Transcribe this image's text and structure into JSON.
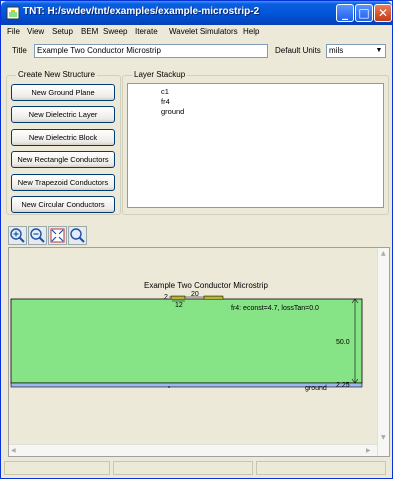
{
  "window": {
    "title": "TNT:  H:/swdev/tnt/examples/example-microstrip-2",
    "minimize_glyph": "_",
    "maximize_glyph": "□",
    "close_glyph": "✕"
  },
  "menu": [
    "File",
    "View",
    "Setup",
    "BEM",
    "Sweep",
    "Iterate",
    "Wavelet Simulators",
    "Help"
  ],
  "title_field": {
    "label": "Title",
    "value": "Example Two Conductor Microstrip"
  },
  "units": {
    "label": "Default Units",
    "value": "mils",
    "arrow": "▼"
  },
  "create_structure": {
    "label": "Create New Structure",
    "buttons": [
      "New Ground Plane",
      "New Dielectric Layer",
      "New Dielectric Block",
      "New Rectangle Conductors",
      "New Trapezoid Conductors",
      "New Circular Conductors"
    ]
  },
  "layer_stackup": {
    "label": "Layer Stackup",
    "items": [
      "c1",
      "fr4",
      "ground"
    ]
  },
  "toolbar": {
    "zoom_buttons": [
      "zoom-in",
      "zoom-out",
      "zoom-fit",
      "zoom-reset"
    ]
  },
  "canvas": {
    "diagram_title": "Example Two Conductor Microstrip",
    "conductor_width": "20",
    "conductor_gap": "12",
    "conductor_edge_label": "2",
    "dielectric_label": "fr4: econst=4.7, lossTan=0.0",
    "dielectric_thickness": "50.0",
    "ground_label": "ground",
    "ground_thickness": "2.25",
    "origin_mark": "o",
    "colors": {
      "dielectric": "#86e486",
      "ground": "#9fb7ef",
      "conductor": "#f0f04a"
    }
  },
  "scroll_arrows": {
    "up": "▲",
    "down": "▼",
    "left": "◀",
    "right": "▶"
  }
}
